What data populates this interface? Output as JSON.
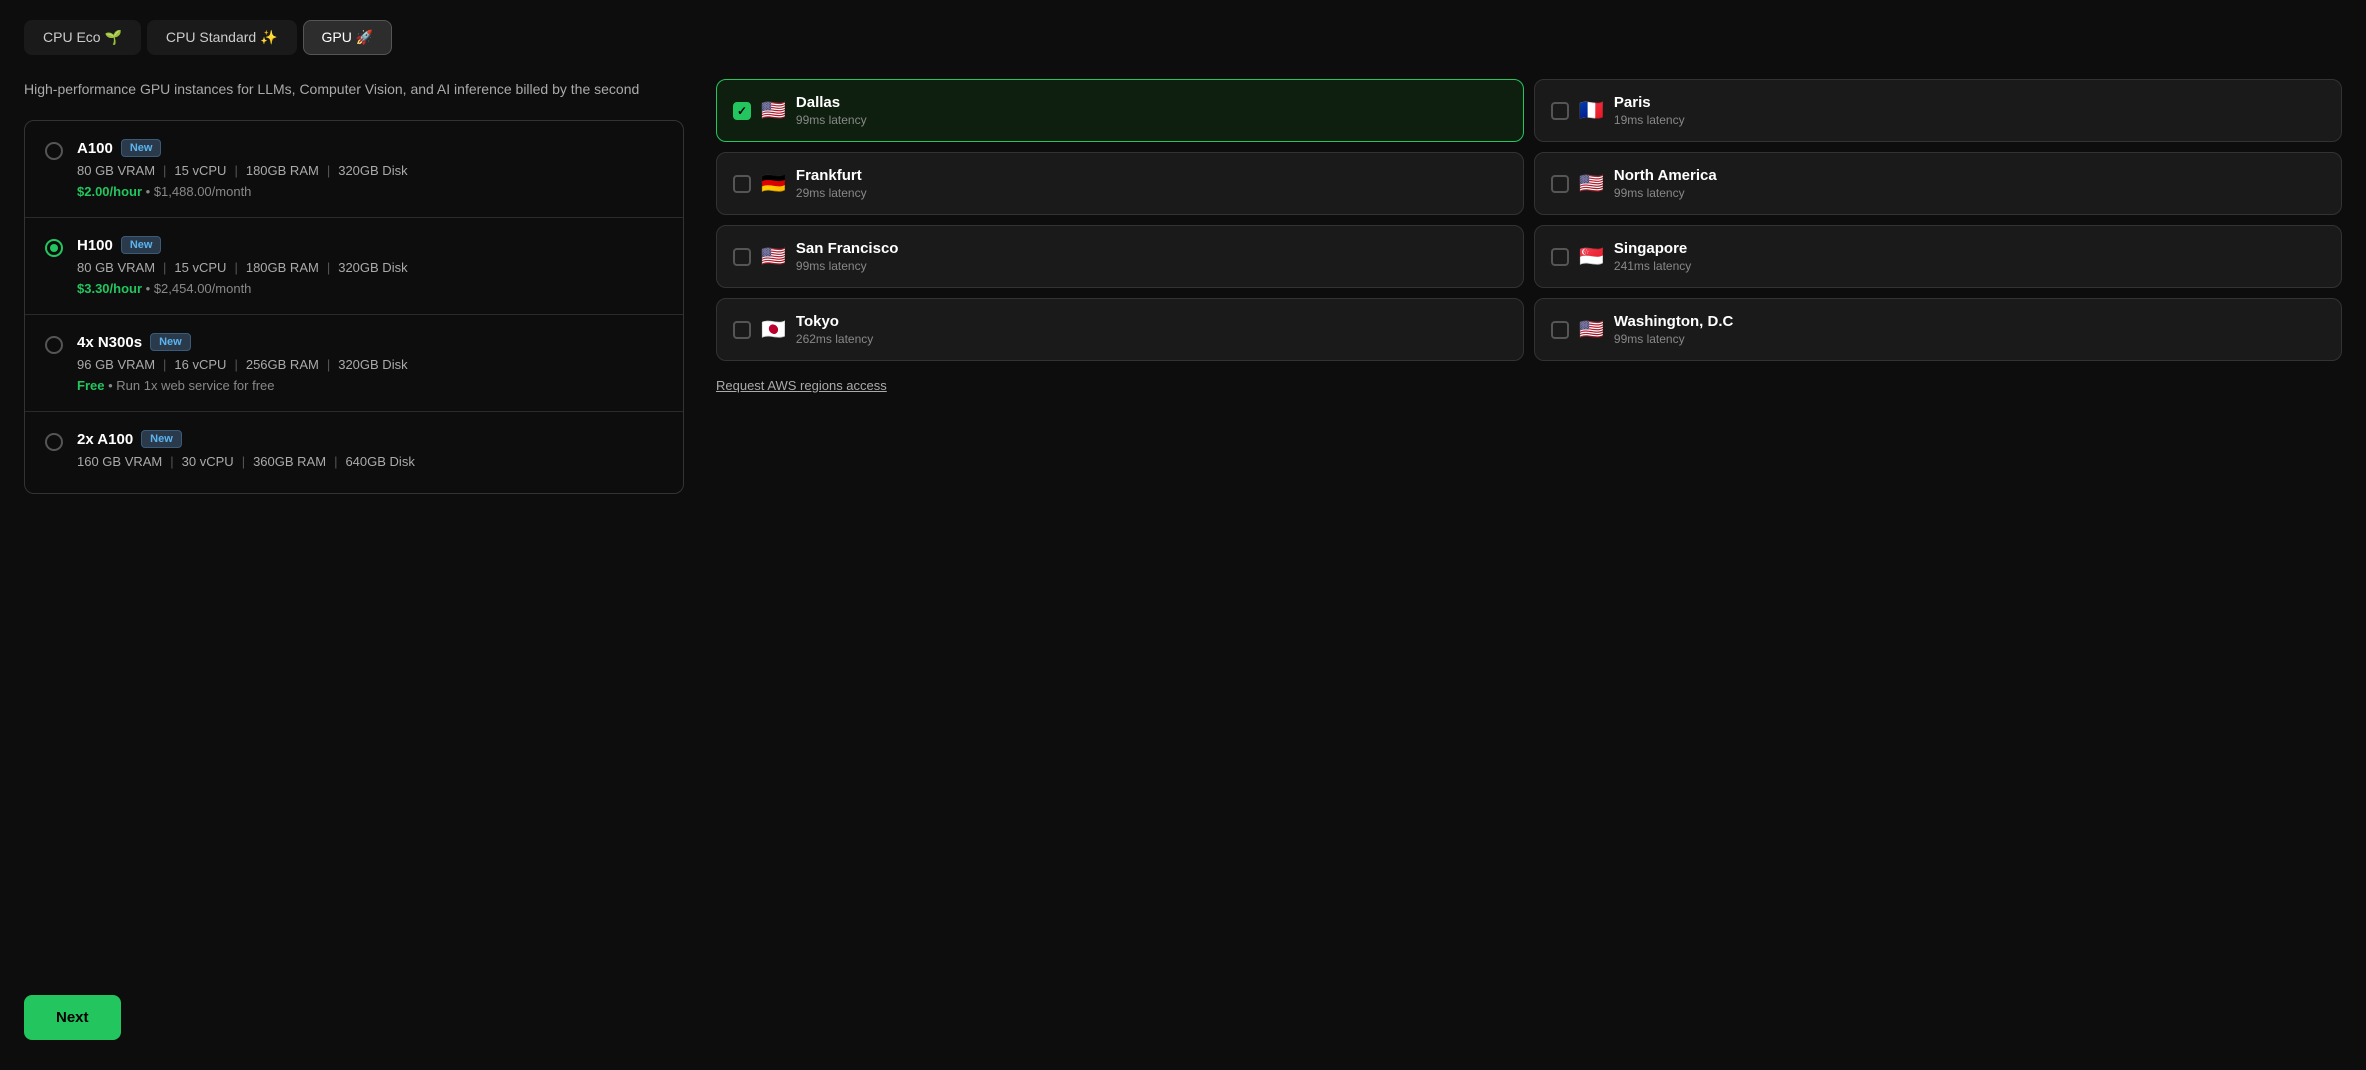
{
  "tabs": [
    {
      "id": "cpu-eco",
      "label": "CPU Eco 🌱",
      "active": false
    },
    {
      "id": "cpu-standard",
      "label": "CPU Standard ✨",
      "active": false
    },
    {
      "id": "gpu",
      "label": "GPU 🚀",
      "active": true
    }
  ],
  "description": "High-performance GPU instances for LLMs, Computer Vision, and AI inference billed by the second",
  "instances": [
    {
      "id": "a100",
      "name": "A100",
      "badge": "New",
      "vram": "80 GB VRAM",
      "vcpu": "15 vCPU",
      "ram": "180GB RAM",
      "disk": "320GB Disk",
      "price_hourly": "$2.00/hour",
      "price_monthly": "$1,488.00/month",
      "selected": false
    },
    {
      "id": "h100",
      "name": "H100",
      "badge": "New",
      "vram": "80 GB VRAM",
      "vcpu": "15 vCPU",
      "ram": "180GB RAM",
      "disk": "320GB Disk",
      "price_hourly": "$3.30/hour",
      "price_monthly": "$2,454.00/month",
      "selected": true
    },
    {
      "id": "4x-n300s",
      "name": "4x N300s",
      "badge": "New",
      "vram": "96 GB VRAM",
      "vcpu": "16 vCPU",
      "ram": "256GB RAM",
      "disk": "320GB Disk",
      "price_free": "Free",
      "price_note": "Run 1x web service for free",
      "selected": false
    },
    {
      "id": "2x-a100",
      "name": "2x A100",
      "badge": "New",
      "vram": "160 GB VRAM",
      "vcpu": "30 vCPU",
      "ram": "360GB RAM",
      "disk": "640GB Disk",
      "price_hourly": "",
      "price_monthly": "",
      "selected": false
    }
  ],
  "regions": [
    {
      "id": "dallas",
      "name": "Dallas",
      "flag": "🇺🇸",
      "latency": "99ms latency",
      "selected": true
    },
    {
      "id": "paris",
      "name": "Paris",
      "flag": "🇫🇷",
      "latency": "19ms latency",
      "selected": false
    },
    {
      "id": "frankfurt",
      "name": "Frankfurt",
      "flag": "🇩🇪",
      "latency": "29ms latency",
      "selected": false
    },
    {
      "id": "north-america",
      "name": "North America",
      "flag": "🇺🇸",
      "latency": "99ms latency",
      "selected": false
    },
    {
      "id": "san-francisco",
      "name": "San Francisco",
      "flag": "🇺🇸",
      "latency": "99ms latency",
      "selected": false
    },
    {
      "id": "singapore",
      "name": "Singapore",
      "flag": "🇸🇬",
      "latency": "241ms latency",
      "selected": false
    },
    {
      "id": "tokyo",
      "name": "Tokyo",
      "flag": "🇯🇵",
      "latency": "262ms latency",
      "selected": false
    },
    {
      "id": "washington-dc",
      "name": "Washington, D.C",
      "flag": "🇺🇸",
      "latency": "99ms latency",
      "selected": false
    }
  ],
  "aws_link_text": "Request AWS regions access",
  "next_button": "Next"
}
